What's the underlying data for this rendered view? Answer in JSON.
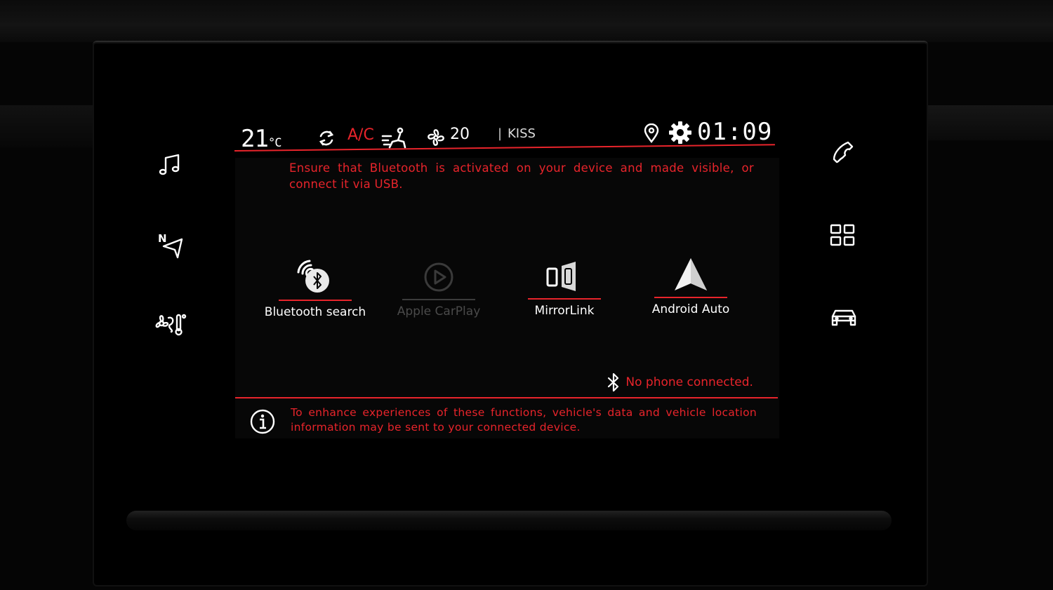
{
  "status_bar": {
    "temperature": "21",
    "temperature_unit": "°C",
    "ac_label": "A/C",
    "fan_speed": "20",
    "separator": "|",
    "radio_station": "KISS",
    "clock": "01:09",
    "icons": [
      "recirculation-icon",
      "seat-airflow-icon",
      "fan-icon",
      "location-pin-icon",
      "settings-gear-icon"
    ]
  },
  "left_nav": {
    "items": [
      {
        "name": "music",
        "icon": "music-note-icon"
      },
      {
        "name": "navigation",
        "icon": "navigation-arrow-icon",
        "badge": "N"
      },
      {
        "name": "climate",
        "icon": "climate-fan-icon"
      }
    ]
  },
  "right_nav": {
    "items": [
      {
        "name": "phone",
        "icon": "phone-handset-icon"
      },
      {
        "name": "apps",
        "icon": "apps-grid-icon"
      },
      {
        "name": "vehicle",
        "icon": "car-icon"
      }
    ]
  },
  "main": {
    "instruction": "Ensure that Bluetooth is activated on your device and made visible, or connect it via USB.",
    "options": [
      {
        "label": "Bluetooth search",
        "icon": "bluetooth-search-icon",
        "enabled": true
      },
      {
        "label": "Apple CarPlay",
        "icon": "play-circle-icon",
        "enabled": false
      },
      {
        "label": "MirrorLink",
        "icon": "mirrorlink-icon",
        "enabled": true
      },
      {
        "label": "Android Auto",
        "icon": "android-auto-icon",
        "enabled": true
      }
    ],
    "connection_status": "No phone connected.",
    "info_text": "To enhance experiences of these functions, vehicle's data and vehicle location information may be sent to your connected device."
  },
  "colors": {
    "accent": "#e8242b",
    "text": "#ffffff",
    "disabled": "#4a4a4a",
    "background": "#000000"
  }
}
